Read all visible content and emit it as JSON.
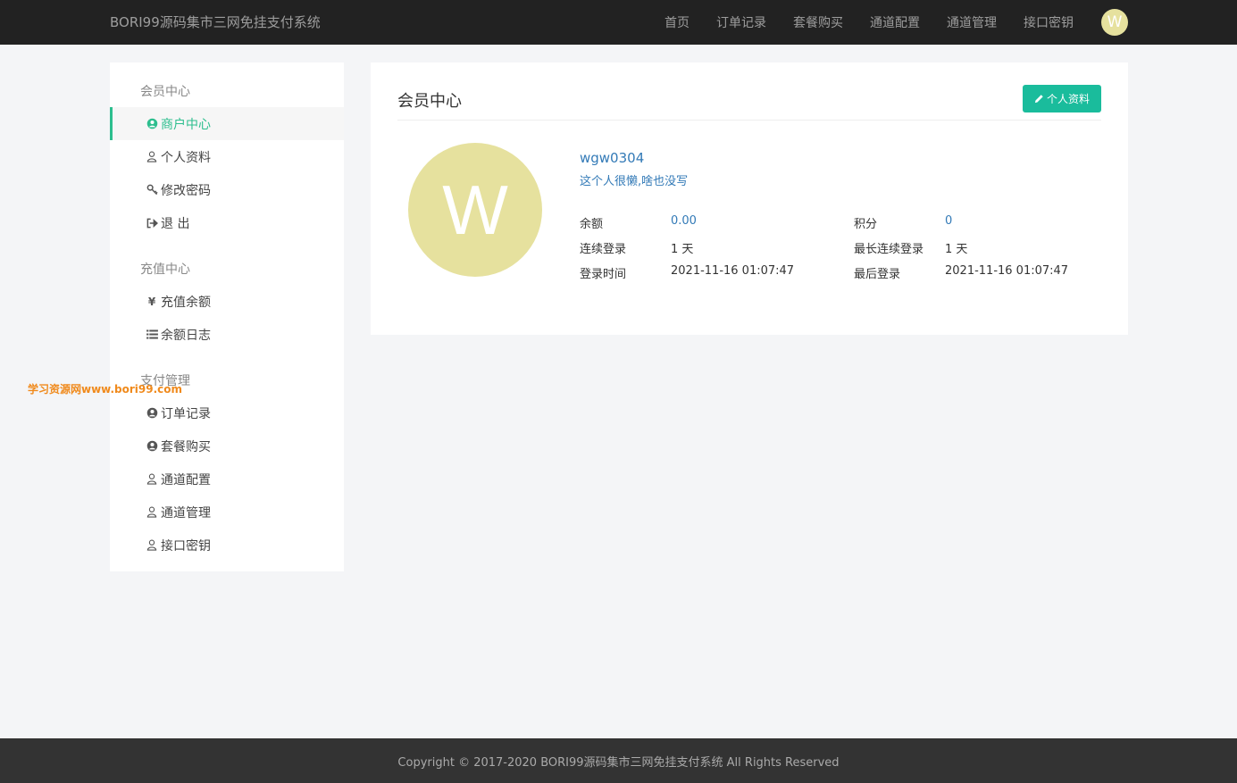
{
  "header": {
    "brand": "BORI99源码集市三网免挂支付系统",
    "nav": [
      "首页",
      "订单记录",
      "套餐购买",
      "通道配置",
      "通道管理",
      "接口密钥"
    ],
    "avatar_letter": "W"
  },
  "sidebar": {
    "groups": [
      {
        "title": "会员中心",
        "items": [
          {
            "label": "商户中心",
            "icon": "user-circle-icon",
            "active": true
          },
          {
            "label": "个人资料",
            "icon": "user-icon"
          },
          {
            "label": "修改密码",
            "icon": "key-icon"
          },
          {
            "label": "退 出",
            "icon": "sign-out-icon"
          }
        ]
      },
      {
        "title": "充值中心",
        "items": [
          {
            "label": "充值余额",
            "icon": "yen-icon"
          },
          {
            "label": "余额日志",
            "icon": "list-icon"
          }
        ]
      },
      {
        "title": "支付管理",
        "items": [
          {
            "label": "订单记录",
            "icon": "user-circle-icon"
          },
          {
            "label": "套餐购买",
            "icon": "user-circle-icon"
          },
          {
            "label": "通道配置",
            "icon": "user-icon"
          },
          {
            "label": "通道管理",
            "icon": "user-icon"
          },
          {
            "label": "接口密钥",
            "icon": "user-icon"
          }
        ]
      }
    ]
  },
  "watermark": "学习资源网www.bori99.com",
  "panel": {
    "title": "会员中心",
    "profile_button": "个人资料",
    "avatar_letter": "W",
    "username": "wgw0304",
    "bio": "这个人很懒,啥也没写",
    "stats": {
      "balance_label": "余额",
      "balance_value": "0.00",
      "points_label": "积分",
      "points_value": "0",
      "streak_label": "连续登录",
      "streak_value": "1 天",
      "max_streak_label": "最长连续登录",
      "max_streak_value": "1 天",
      "login_time_label": "登录时间",
      "login_time_value": "2021-11-16 01:07:47",
      "last_login_label": "最后登录",
      "last_login_value": "2021-11-16 01:07:47"
    }
  },
  "footer": {
    "copyright": "Copyright © 2017-2020 BORI99源码集市三网免挂支付系统 All Rights Reserved"
  },
  "colors": {
    "topbar": "#222222",
    "accent_green": "#2dbe8e",
    "button_teal": "#1abc9c",
    "link_blue": "#337ab7",
    "avatar_bg": "#e6e19e"
  }
}
